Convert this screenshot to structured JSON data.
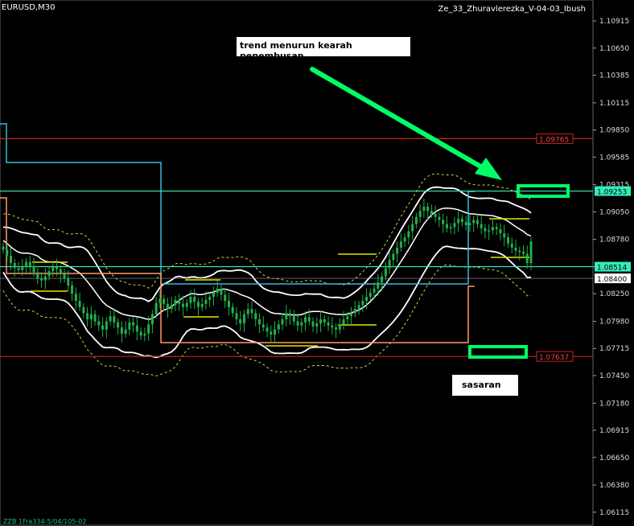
{
  "header": {
    "symbol": "EURUSD,M30",
    "expert": "Ze_33_Zhuravlerezka_V-04-03_Ibush"
  },
  "annotations": {
    "trend_note": "trend menurun kearah penembusan",
    "target_note": "sasaran"
  },
  "footer_text": "ZZB 1Fra334-5/04/105-02",
  "colors": {
    "background": "#000000",
    "grid": "#1a1a1a",
    "candle": "#22b14c",
    "bollinger": "#ffffff",
    "ma_dashed": "#e6e64d",
    "level": "#e6e600",
    "cyan_line": "#33bbdd",
    "orange_line": "#ff9966",
    "teal_line": "#33eebb",
    "red_line": "#cc2222",
    "green_arrow": "#00ff66",
    "green_box": "#00ff66"
  },
  "chart_data": {
    "type": "candlestick",
    "y_ticks": [
      "1.10915",
      "1.10650",
      "1.10385",
      "1.10115",
      "1.09850",
      "1.09585",
      "1.09315",
      "1.09050",
      "1.08780",
      "1.08515",
      "1.08250",
      "1.07980",
      "1.07715",
      "1.07450",
      "1.07180",
      "1.06915",
      "1.06650",
      "1.06380",
      "1.06115"
    ],
    "ylim": [
      1.0598,
      1.1112
    ],
    "price_tags": [
      {
        "label": "1.09765",
        "value": 1.09765,
        "style": "red"
      },
      {
        "label": "1.09253",
        "value": 1.09253,
        "style": "teal"
      },
      {
        "label": "1.08514",
        "value": 1.08514,
        "style": "teal"
      },
      {
        "label": "1.08400",
        "value": 1.084,
        "style": "white"
      },
      {
        "label": "1.07637",
        "value": 1.07637,
        "style": "red"
      }
    ],
    "horizontal_lines": [
      {
        "name": "resistance-red",
        "value": 1.09765,
        "color": "#cc2222"
      },
      {
        "name": "resistance-teal",
        "value": 1.09253,
        "color": "#33eebb"
      },
      {
        "name": "support-teal",
        "value": 1.08514,
        "color": "#33eebb"
      },
      {
        "name": "support-red",
        "value": 1.07637,
        "color": "#cc2222"
      }
    ],
    "close_series": [
      1.0868,
      1.0862,
      1.0855,
      1.085,
      1.0848,
      1.0851,
      1.0856,
      1.0852,
      1.0846,
      1.084,
      1.0838,
      1.0842,
      1.0847,
      1.0851,
      1.0849,
      1.0844,
      1.084,
      1.0833,
      1.0825,
      1.0818,
      1.0812,
      1.0806,
      1.08,
      1.0805,
      1.0798,
      1.0794,
      1.079,
      1.0798,
      1.0803,
      1.0797,
      1.0792,
      1.0786,
      1.079,
      1.0797,
      1.0794,
      1.0788,
      1.0784,
      1.0786,
      1.0795,
      1.0805,
      1.0816,
      1.082,
      1.0815,
      1.081,
      1.0814,
      1.0819,
      1.0815,
      1.0812,
      1.0816,
      1.0822,
      1.0817,
      1.0812,
      1.0815,
      1.0819,
      1.0822,
      1.0826,
      1.083,
      1.0824,
      1.0818,
      1.0812,
      1.0806,
      1.08,
      1.0796,
      1.0805,
      1.081,
      1.0806,
      1.08,
      1.0795,
      1.0792,
      1.0788,
      1.0785,
      1.079,
      1.0795,
      1.08,
      1.0806,
      1.0803,
      1.0798,
      1.0794,
      1.0797,
      1.0802,
      1.0798,
      1.0793,
      1.0796,
      1.08,
      1.0797,
      1.0794,
      1.0792,
      1.079,
      1.0795,
      1.08,
      1.0803,
      1.0806,
      1.081,
      1.0814,
      1.0818,
      1.0822,
      1.0826,
      1.083,
      1.0836,
      1.0842,
      1.085,
      1.0858,
      1.0864,
      1.087,
      1.0876,
      1.088,
      1.0886,
      1.0893,
      1.09,
      1.0906,
      1.091,
      1.0906,
      1.0903,
      1.09,
      1.0897,
      1.0893,
      1.0889,
      1.089,
      1.0894,
      1.0898,
      1.0895,
      1.0892,
      1.0894,
      1.0897,
      1.0893,
      1.0889,
      1.0886,
      1.0887,
      1.089,
      1.0888,
      1.0884,
      1.088,
      1.0874,
      1.087,
      1.0867,
      1.0866,
      1.0864,
      1.0855,
      1.0876
    ]
  }
}
